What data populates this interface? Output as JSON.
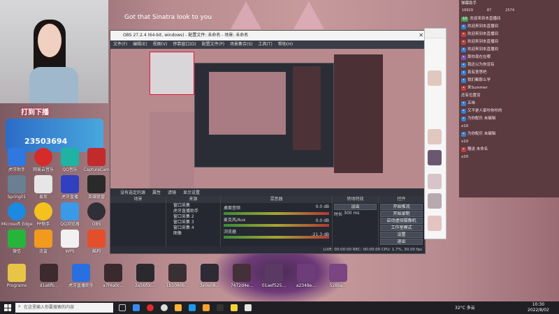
{
  "overlay": {
    "song_text": "Got that Sinatra look to you",
    "stream_caption": "打到下播"
  },
  "desktop_icons": [
    {
      "label": "虎牙助手"
    },
    {
      "label": "网易云音乐"
    },
    {
      "label": "QQ音乐"
    },
    {
      "label": "CaptureCam"
    },
    {
      "label": "Spring01"
    },
    {
      "label": "易剪"
    },
    {
      "label": "虎牙直播"
    },
    {
      "label": "英雄联盟"
    },
    {
      "label": "Microsoft Edge"
    },
    {
      "label": "PP助手"
    },
    {
      "label": "QQ浏览器"
    },
    {
      "label": "OBS"
    },
    {
      "label": "微信"
    },
    {
      "label": "迅雷"
    },
    {
      "label": "WPS"
    },
    {
      "label": "酷狗"
    },
    {
      "label": "Programs"
    },
    {
      "label": "d1a6fb..."
    },
    {
      "label": "虎牙直播助手"
    },
    {
      "label": "a7f4a0c..."
    },
    {
      "label": "2a56f0c..."
    },
    {
      "label": "1b1080b..."
    },
    {
      "label": "3e0e08..."
    },
    {
      "label": "7472d4e..."
    },
    {
      "label": "01aef525..."
    },
    {
      "label": "a2348e..."
    },
    {
      "label": "528ba..."
    }
  ],
  "stream_overlay_text": {
    "header": "打到下播",
    "line": "23503694"
  },
  "obs": {
    "title": "OBS 27.2.4 (64-bit, windows) - 配置文件: 未命名 - 场景: 未命名",
    "menu": [
      "文件(F)",
      "编辑(E)",
      "视图(V)",
      "停靠窗口(D)",
      "配置文件(P)",
      "场景集合(S)",
      "工具(T)",
      "帮助(H)"
    ],
    "context_bar": [
      "没有选定的源",
      "属性",
      "滤镜",
      "显示设置"
    ],
    "docks": {
      "scenes": "场景",
      "sources": "来源",
      "mixer": "混音器",
      "transitions": "转场特效",
      "controls": "控件"
    },
    "sources": [
      "窗口采集",
      "虎牙直播助手",
      "窗口采集 2",
      "窗口采集 3",
      "窗口采集 4",
      "图像"
    ],
    "mixer_channels": [
      {
        "name": "桌面音频",
        "db": "0.0 dB"
      },
      {
        "name": "麦克风/Aux",
        "db": "0.0 dB"
      },
      {
        "name": "浏览器",
        "db": "-21.3 dB"
      }
    ],
    "transition": {
      "type": "淡出",
      "duration_label": "时长",
      "duration": "300 ms"
    },
    "controls": [
      "开始推流",
      "开始录制",
      "启动虚拟摄像机",
      "工作室模式",
      "设置",
      "退出"
    ],
    "status": "LIVE: 00:00:00  REC: 00:00:00  CPU: 1.7%, 30.00 fps"
  },
  "chat": {
    "header": "弹幕助手",
    "stats": [
      "18929",
      "87",
      "2574"
    ],
    "messages": [
      {
        "badge": "10",
        "text": "欢迎来到本直播间"
      },
      {
        "badge": "",
        "text": "欢迎来到本直播间"
      },
      {
        "badge": "",
        "text": "欢迎来到本直播间"
      },
      {
        "badge": "",
        "text": "欢迎来到本直播间"
      },
      {
        "badge": "",
        "text": "欢迎来到本直播间"
      },
      {
        "badge": "",
        "text": "那你现在在哪"
      },
      {
        "badge": "",
        "text": "我还以为你没有"
      },
      {
        "badge": "",
        "text": "真有意思吧"
      },
      {
        "badge": "",
        "text": "我们都那么学"
      },
      {
        "badge": "",
        "text": "来Summer"
      },
      {
        "badge": "",
        "text": "还有位置没"
      },
      {
        "badge": "",
        "text": "五味"
      },
      {
        "badge": "",
        "text": "又不是人家吵你吵的"
      },
      {
        "badge": "",
        "text": "为你配乐 未编辑"
      },
      {
        "badge": "",
        "text": "x10"
      },
      {
        "badge": "",
        "text": "为你配乐 未编辑"
      },
      {
        "badge": "",
        "text": "x10"
      },
      {
        "badge": "",
        "text": "赠送 未命名"
      },
      {
        "badge": "",
        "text": "x20"
      }
    ]
  },
  "taskbar": {
    "search_placeholder": "在这里输入你要搜索的内容",
    "temperature": "32°C 多云",
    "time": "10:30",
    "date": "2022/8/02"
  }
}
